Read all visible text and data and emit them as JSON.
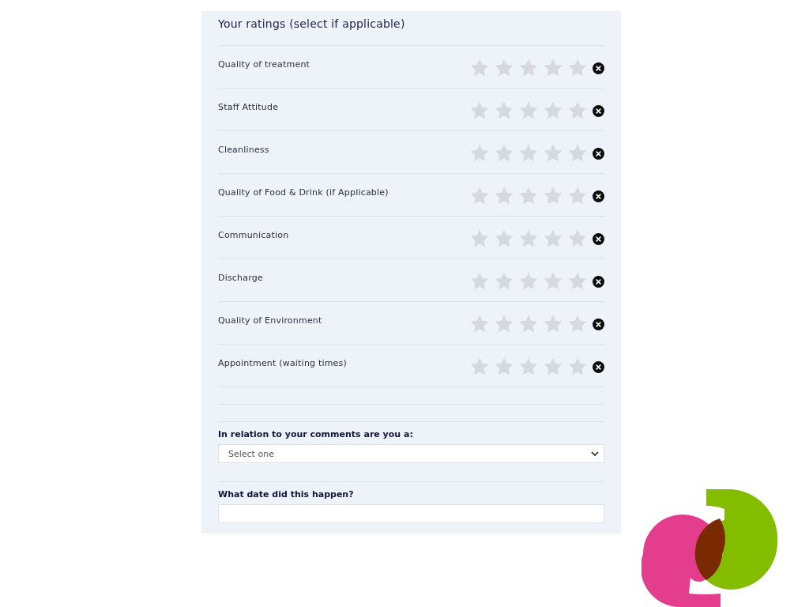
{
  "title": "Your ratings (select if applicable)",
  "ratings": [
    {
      "label": "Quality of treatment",
      "stars": 0
    },
    {
      "label": "Staff Attitude",
      "stars": 0
    },
    {
      "label": "Cleanliness",
      "stars": 0
    },
    {
      "label": "Quality of Food & Drink (if Applicable)",
      "stars": 0
    },
    {
      "label": "Communication",
      "stars": 0
    },
    {
      "label": "Discharge",
      "stars": 0
    },
    {
      "label": "Quality of Environment",
      "stars": 0
    },
    {
      "label": "Appointment (waiting times)",
      "stars": 0
    }
  ],
  "role_question": {
    "label": "In relation to your comments are you a:",
    "placeholder": "Select one"
  },
  "date_question": {
    "label": "What date did this happen?"
  }
}
